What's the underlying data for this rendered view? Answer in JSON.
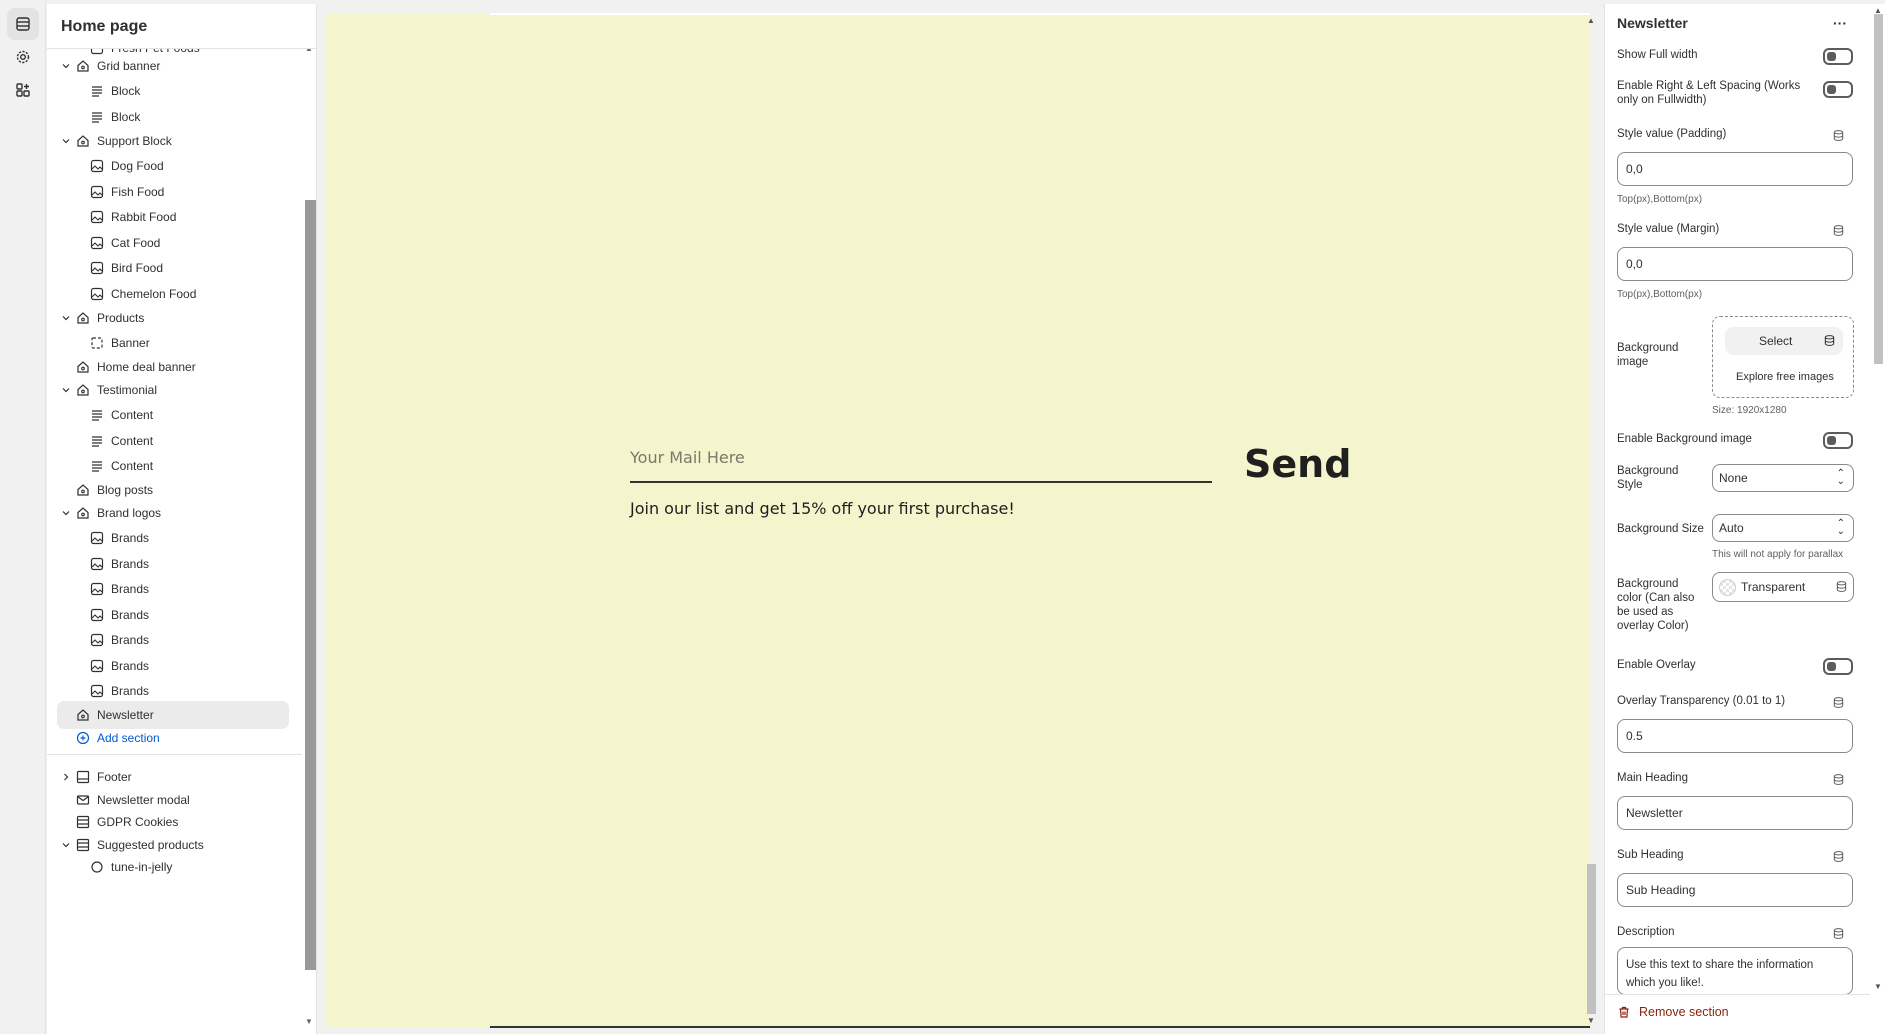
{
  "sidebar": {
    "title": "Home page",
    "tree": {
      "r0": "Fresh Pet Foods",
      "r1": "Grid banner",
      "r2": "Block",
      "r3": "Block",
      "r4": "Support Block",
      "r5": "Dog Food",
      "r6": "Fish Food",
      "r7": "Rabbit Food",
      "r8": "Cat Food",
      "r9": "Bird Food",
      "r10": "Chemelon Food",
      "r11": "Products",
      "r12": "Banner",
      "r13": "Home deal banner",
      "r14": "Testimonial",
      "r15": "Content",
      "r16": "Content",
      "r17": "Content",
      "r18": "Blog posts",
      "r19": "Brand logos",
      "r20": "Brands",
      "r21": "Brands",
      "r22": "Brands",
      "r23": "Brands",
      "r24": "Brands",
      "r25": "Brands",
      "r26": "Brands",
      "r27": "Newsletter",
      "r28": "Add section",
      "r29": "Footer",
      "r30": "Newsletter modal",
      "r31": "GDPR Cookies",
      "r32": "Suggested products",
      "r33": "tune-in-jelly"
    }
  },
  "preview": {
    "email_placeholder": "Your Mail Here",
    "send_label": "Send",
    "subheading": "Join our list and get 15% off your first purchase!",
    "background_color": "#f4f5cd"
  },
  "panel": {
    "title": "Newsletter",
    "more_label": "···",
    "show_full_width": "Show Full width",
    "enable_spacing": "Enable Right & Left Spacing (Works only on Fullwidth)",
    "padding_label": "Style value (Padding)",
    "padding_value": "0,0",
    "padding_hint": "Top(px),Bottom(px)",
    "margin_label": "Style value (Margin)",
    "margin_value": "0,0",
    "margin_hint": "Top(px),Bottom(px)",
    "bg_image_label": "Background image",
    "select_label": "Select",
    "explore_label": "Explore free images",
    "size_hint": "Size: 1920x1280",
    "enable_bg_image": "Enable Background image",
    "bg_style_label": "Background Style",
    "bg_style_value": "None",
    "bg_size_label": "Background Size",
    "bg_size_value": "Auto",
    "bg_size_hint": "This will not apply for parallax",
    "bg_color_label": "Background color (Can also be used as overlay Color)",
    "bg_color_value": "Transparent",
    "enable_overlay": "Enable Overlay",
    "overlay_label": "Overlay Transparency (0.01 to 1)",
    "overlay_value": "0.5",
    "main_heading_label": "Main Heading",
    "main_heading_value": "Newsletter",
    "sub_heading_label": "Sub Heading",
    "sub_heading_value": "Sub Heading",
    "description_label": "Description",
    "description_value": "Use this text to share the information which you like!.",
    "remove_label": "Remove section"
  }
}
